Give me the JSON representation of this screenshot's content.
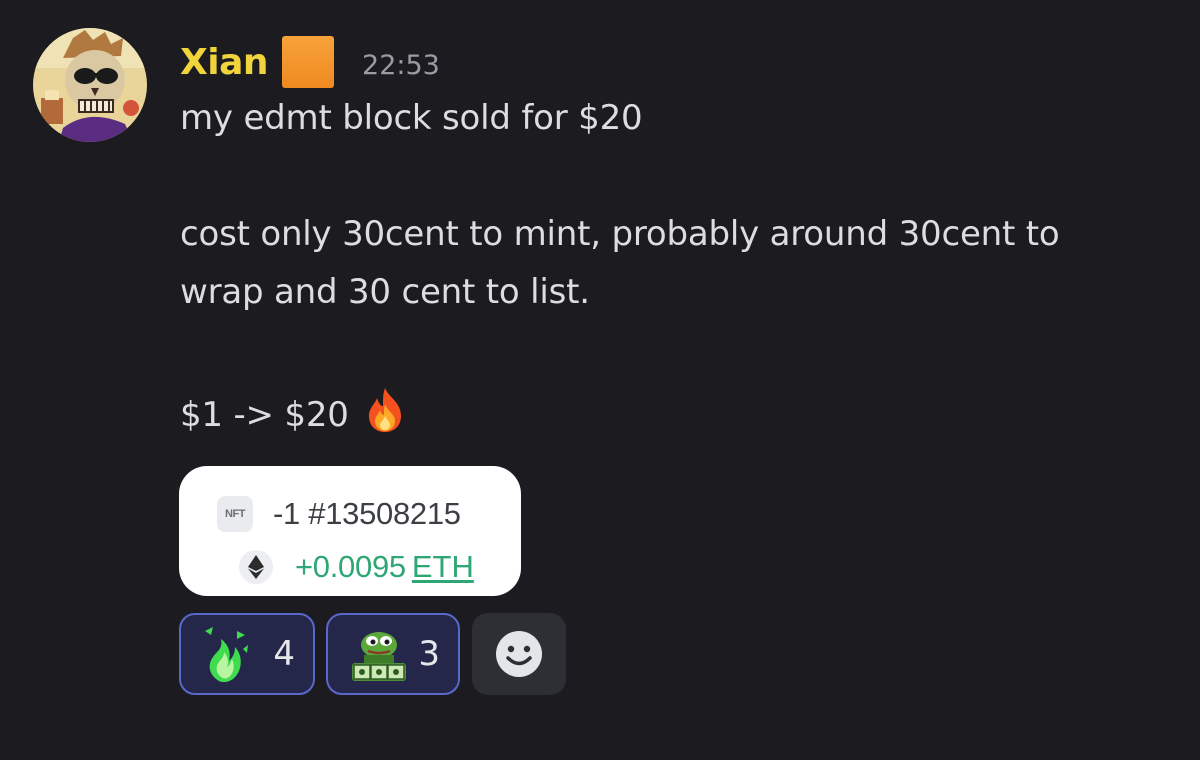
{
  "message": {
    "author": "Xian",
    "timestamp": "22:53",
    "lines": [
      "my edmt block sold for $20",
      "cost only 30cent to mint, probably around 30cent to",
      "wrap and 30 cent to list.",
      "$1 -> $20"
    ],
    "line_emoji": "fire-icon"
  },
  "embed": {
    "nft_badge": "NFT",
    "nft_change": "-1 #13508215",
    "eth_change": "+0.0095",
    "eth_unit": "ETH"
  },
  "reactions": [
    {
      "emoji": "green-flame-emoji",
      "count": "4"
    },
    {
      "emoji": "pepe-money-emoji",
      "count": "3"
    }
  ],
  "colors": {
    "background": "#1c1c20",
    "username": "#f0d43c",
    "role_badge": "#f39a2e",
    "eth_green": "#2fa774",
    "reaction_border": "#5b67c9",
    "reaction_bg": "#25274a"
  }
}
